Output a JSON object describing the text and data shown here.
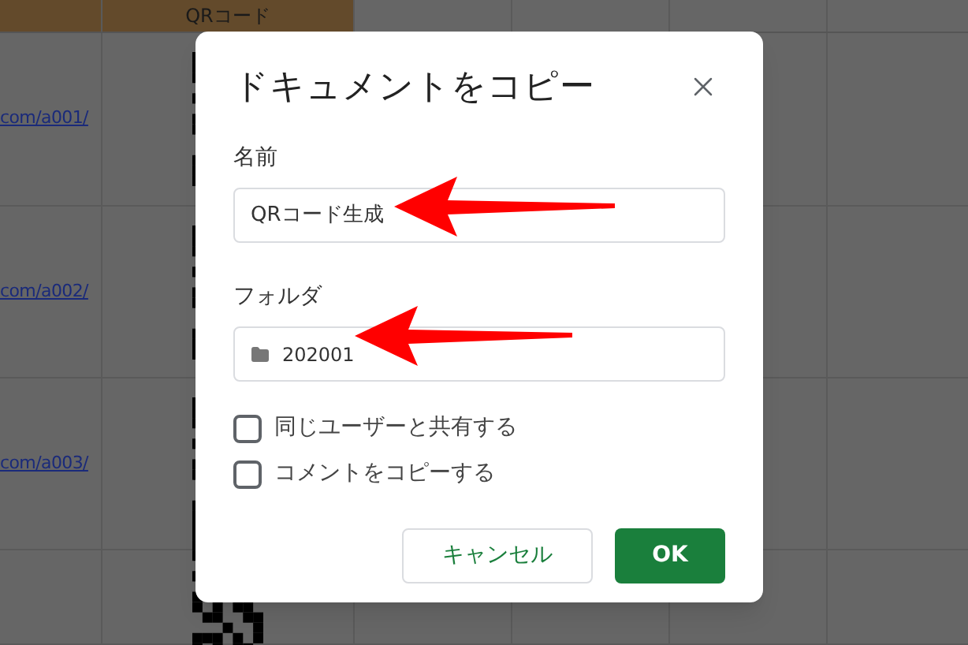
{
  "sheet": {
    "header_label": "QRコード",
    "rows": [
      {
        "link": "com/a001/"
      },
      {
        "link": "com/a002/"
      },
      {
        "link": "com/a003/"
      }
    ]
  },
  "dialog": {
    "title": "ドキュメントをコピー",
    "fields": [
      {
        "kind": "text",
        "label": "名前",
        "value": "QRコード生成"
      },
      {
        "kind": "folder",
        "label": "フォルダ",
        "value": "202001"
      }
    ],
    "checkboxes": [
      {
        "label": "同じユーザーと共有する",
        "checked": false
      },
      {
        "label": "コメントをコピーする",
        "checked": false
      }
    ],
    "buttons": [
      {
        "kind": "secondary",
        "label": "キャンセル"
      },
      {
        "kind": "primary",
        "label": "OK"
      }
    ]
  }
}
